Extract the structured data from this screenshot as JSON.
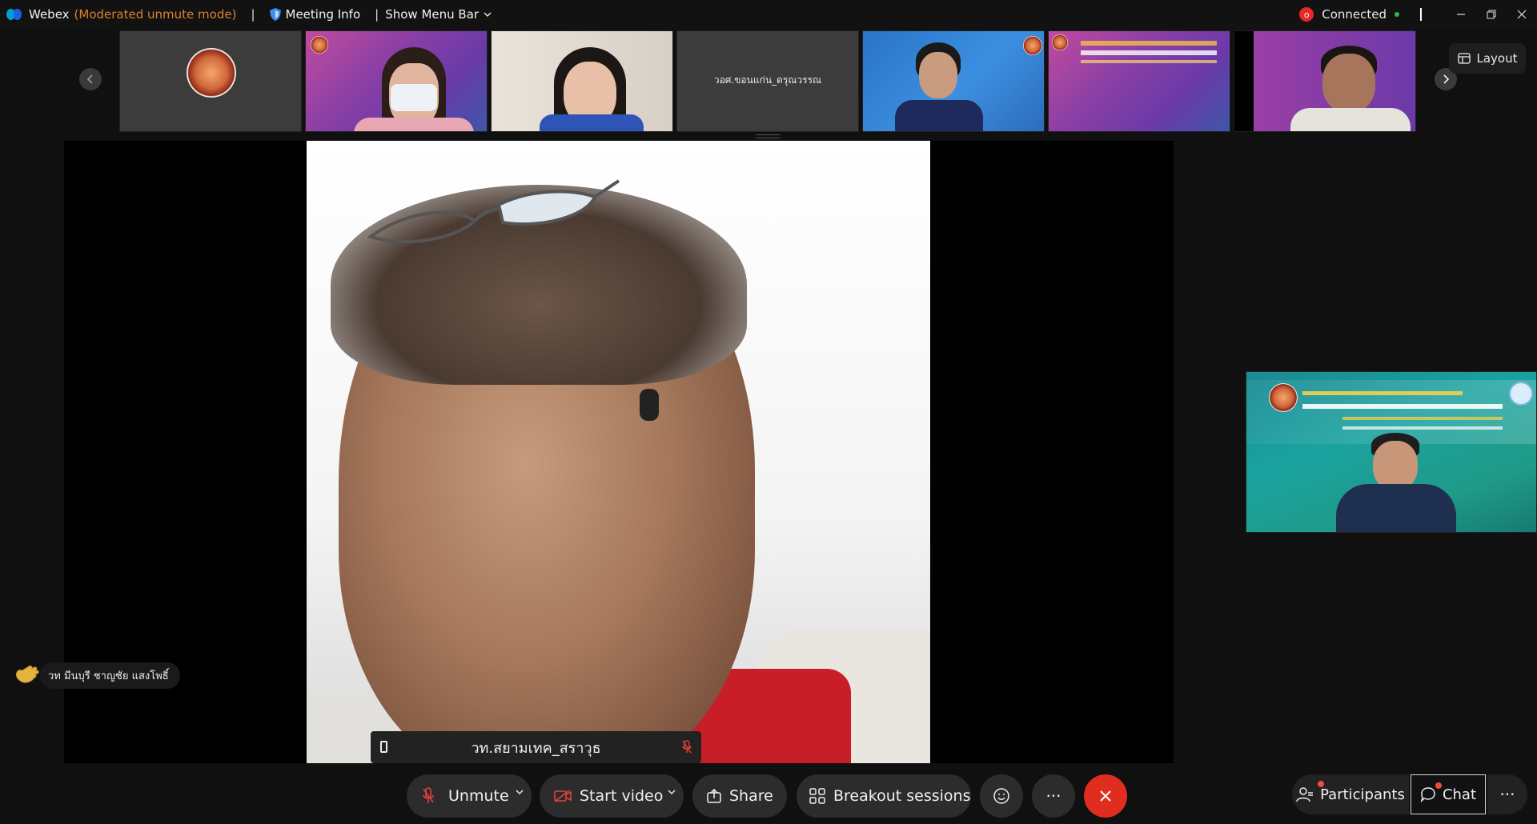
{
  "titlebar": {
    "app_name": "Webex",
    "mode": "(Moderated unmute mode)",
    "separator": "|",
    "meeting_info": "Meeting Info",
    "separator2": "|",
    "show_menu_bar": "Show Menu Bar",
    "connection_status": "Connected",
    "connection_badge": "o"
  },
  "strip": {
    "layout_label": "Layout",
    "thumbnails": [
      {
        "label": ""
      },
      {
        "label": ""
      },
      {
        "label": ""
      },
      {
        "label": "วอศ.ขอนแก่น_ดรุณวรรณ"
      },
      {
        "label": ""
      },
      {
        "label": ""
      },
      {
        "label": ""
      }
    ]
  },
  "main_video": {
    "participant_name": "วท.สยามเทค_สราวุธ"
  },
  "raised_hand": {
    "name": "วท มีนบุรี ชาญชัย แสงโพธิ์"
  },
  "controls": {
    "unmute": "Unmute",
    "start_video": "Start video",
    "share": "Share",
    "breakout": "Breakout sessions",
    "more": "···",
    "participants": "Participants",
    "chat": "Chat",
    "more_side": "···"
  },
  "colors": {
    "leave_red": "#e02d20",
    "mode_orange": "#d9822b",
    "status_green": "#2fb34a",
    "notify_red": "#f04b3e"
  }
}
